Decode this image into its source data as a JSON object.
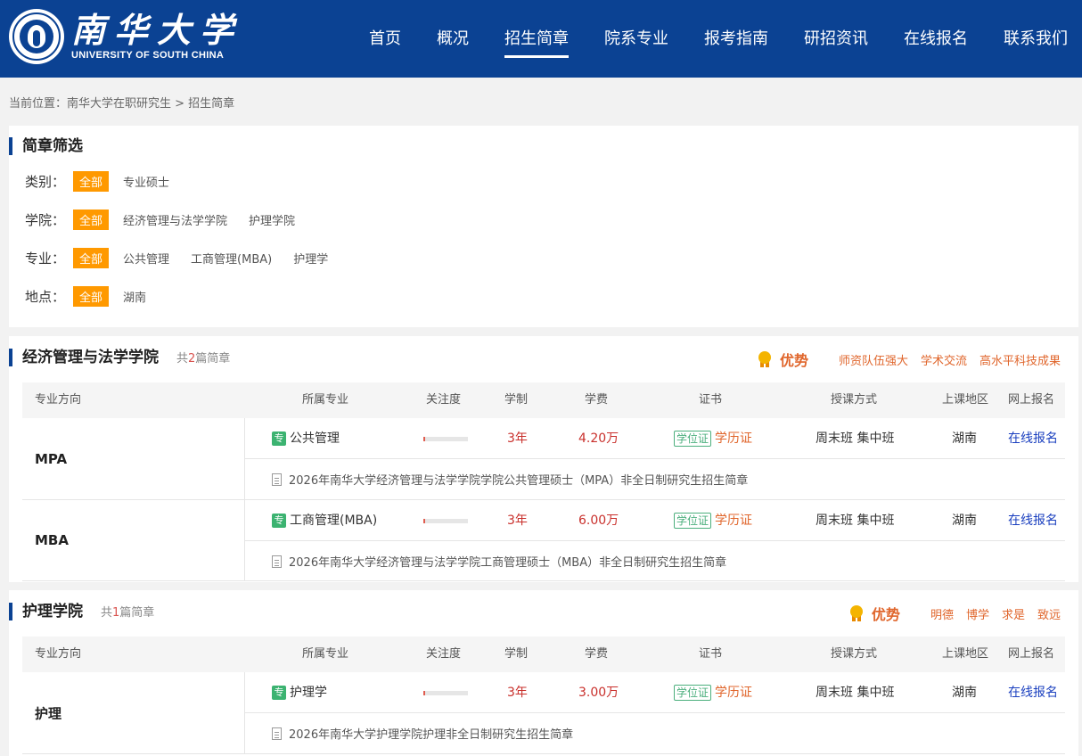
{
  "header": {
    "brand_cn": "南华大学",
    "brand_en": "UNIVERSITY OF SOUTH CHINA",
    "nav": [
      {
        "label": "首页"
      },
      {
        "label": "概况"
      },
      {
        "label": "招生简章",
        "active": true
      },
      {
        "label": "院系专业"
      },
      {
        "label": "报考指南"
      },
      {
        "label": "研招资讯"
      },
      {
        "label": "在线报名"
      },
      {
        "label": "联系我们"
      }
    ]
  },
  "breadcrumb": "当前位置：南华大学在职研究生 > 招生简章",
  "filter": {
    "title": "简章筛选",
    "rows": [
      {
        "label": "类别：",
        "options": [
          "全部",
          "专业硕士"
        ]
      },
      {
        "label": "学院：",
        "options": [
          "全部",
          "经济管理与法学学院",
          "护理学院"
        ]
      },
      {
        "label": "专业：",
        "options": [
          "全部",
          "公共管理",
          "工商管理(MBA)",
          "护理学"
        ]
      },
      {
        "label": "地点：",
        "options": [
          "全部",
          "湖南"
        ]
      }
    ]
  },
  "table_headers": [
    "专业方向",
    "所属专业",
    "关注度",
    "学制",
    "学费",
    "证书",
    "授课方式",
    "上课地区",
    "网上报名"
  ],
  "colleges": [
    {
      "name": "经济管理与法学学院",
      "count_prefix": "共",
      "count": "2",
      "count_suffix": "篇简章",
      "adv_title": "优势",
      "advantages": [
        "师资队伍强大",
        "学术交流",
        "高水平科技成果"
      ],
      "rows": [
        {
          "direction": "MPA",
          "tag": "专",
          "major": "公共管理",
          "attention": 0.04,
          "years": "3年",
          "fee": "4.20万",
          "cert_box": "学位证",
          "cert_text": "学历证",
          "mode": "周末班 集中班",
          "region": "湖南",
          "apply": "在线报名",
          "brochure": "2026年南华大学经济管理与法学学院学院公共管理硕士（MPA）非全日制研究生招生简章"
        },
        {
          "direction": "MBA",
          "tag": "专",
          "major": "工商管理(MBA)",
          "attention": 0.04,
          "years": "3年",
          "fee": "6.00万",
          "cert_box": "学位证",
          "cert_text": "学历证",
          "mode": "周末班 集中班",
          "region": "湖南",
          "apply": "在线报名",
          "brochure": "2026年南华大学经济管理与法学学院工商管理硕士（MBA）非全日制研究生招生简章"
        }
      ]
    },
    {
      "name": "护理学院",
      "count_prefix": "共",
      "count": "1",
      "count_suffix": "篇简章",
      "adv_title": "优势",
      "advantages": [
        "明德",
        "博学",
        "求是",
        "致远"
      ],
      "rows": [
        {
          "direction": "护理",
          "tag": "专",
          "major": "护理学",
          "attention": 0.04,
          "years": "3年",
          "fee": "3.00万",
          "cert_box": "学位证",
          "cert_text": "学历证",
          "mode": "周末班 集中班",
          "region": "湖南",
          "apply": "在线报名",
          "brochure": "2026年南华大学护理学院护理非全日制研究生招生简章"
        }
      ]
    }
  ],
  "colors": {
    "header_bg": "#0b4293",
    "accent_orange": "#ff9900",
    "advantage": "#e0662c",
    "link_blue": "#1a3fbf"
  }
}
